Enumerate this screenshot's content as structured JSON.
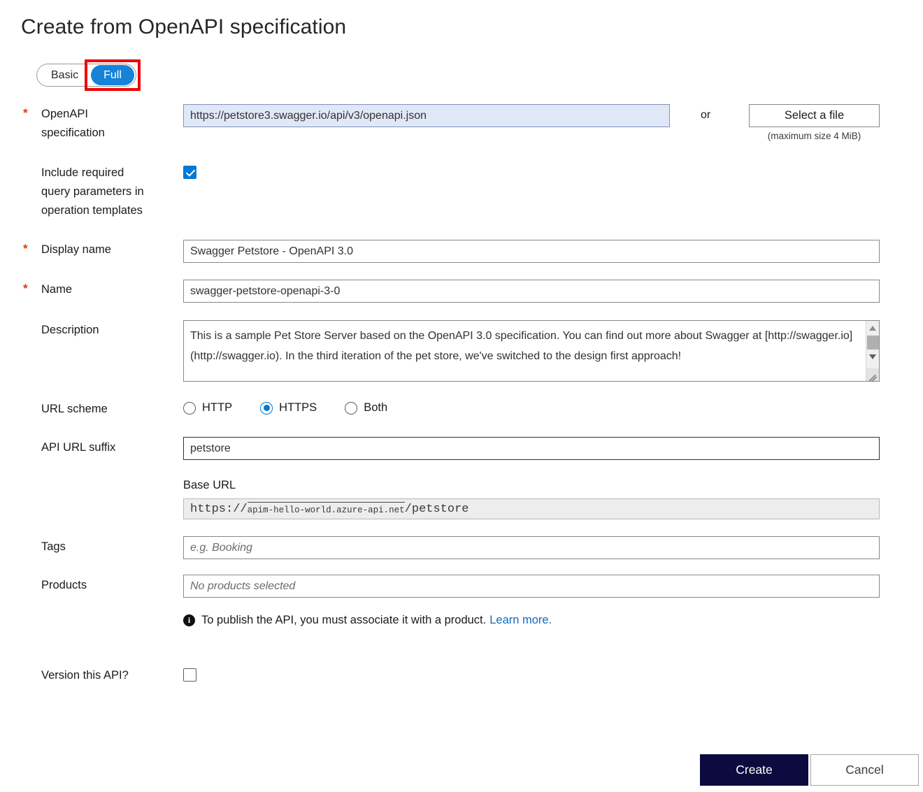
{
  "page": {
    "title": "Create from OpenAPI specification"
  },
  "mode_toggle": {
    "basic_label": "Basic",
    "full_label": "Full",
    "selected": "Full",
    "selected_color": "#1683d8",
    "annotation_color": "#ee0000"
  },
  "fields": {
    "openapi_spec": {
      "label_line1": "OpenAPI",
      "label_line2": "specification",
      "required_marker": "*",
      "value": "https://petstore3.swagger.io/api/v3/openapi.json",
      "or_text": "or",
      "file_button": "Select a file",
      "file_note": "(maximum size 4 MiB)"
    },
    "include_required_query_params": {
      "label_line1": "Include required",
      "label_line2": "query parameters in",
      "label_line3": "operation templates",
      "checked": true
    },
    "display_name": {
      "label": "Display name",
      "required_marker": "*",
      "value": "Swagger Petstore - OpenAPI 3.0"
    },
    "name": {
      "label": "Name",
      "required_marker": "*",
      "value": "swagger-petstore-openapi-3-0"
    },
    "description": {
      "label": "Description",
      "value": "This is a sample Pet Store Server based on the OpenAPI 3.0 specification.  You can find out more about Swagger at [http://swagger.io](http://swagger.io). In the third iteration of the pet store, we've switched to the design first approach!"
    },
    "url_scheme": {
      "label": "URL scheme",
      "options": [
        "HTTP",
        "HTTPS",
        "Both"
      ],
      "selected": "HTTPS"
    },
    "api_url_suffix": {
      "label": "API URL suffix",
      "value": "petstore"
    },
    "base_url": {
      "label": "Base URL",
      "scheme": "https://",
      "host": "apim-hello-world.azure-api.net",
      "separator": "/",
      "suffix": "petstore"
    },
    "tags": {
      "label": "Tags",
      "value": "",
      "placeholder": "e.g. Booking"
    },
    "products": {
      "label": "Products",
      "value": "",
      "placeholder": "No products selected"
    },
    "product_info": {
      "text": "To publish the API, you must associate it with a product.",
      "link_text": "Learn more.",
      "link_color": "#0f6cbd"
    },
    "version_api": {
      "label": "Version this API?",
      "checked": false
    }
  },
  "actions": {
    "create_label": "Create",
    "cancel_label": "Cancel",
    "create_bg": "#0d0a3f"
  }
}
